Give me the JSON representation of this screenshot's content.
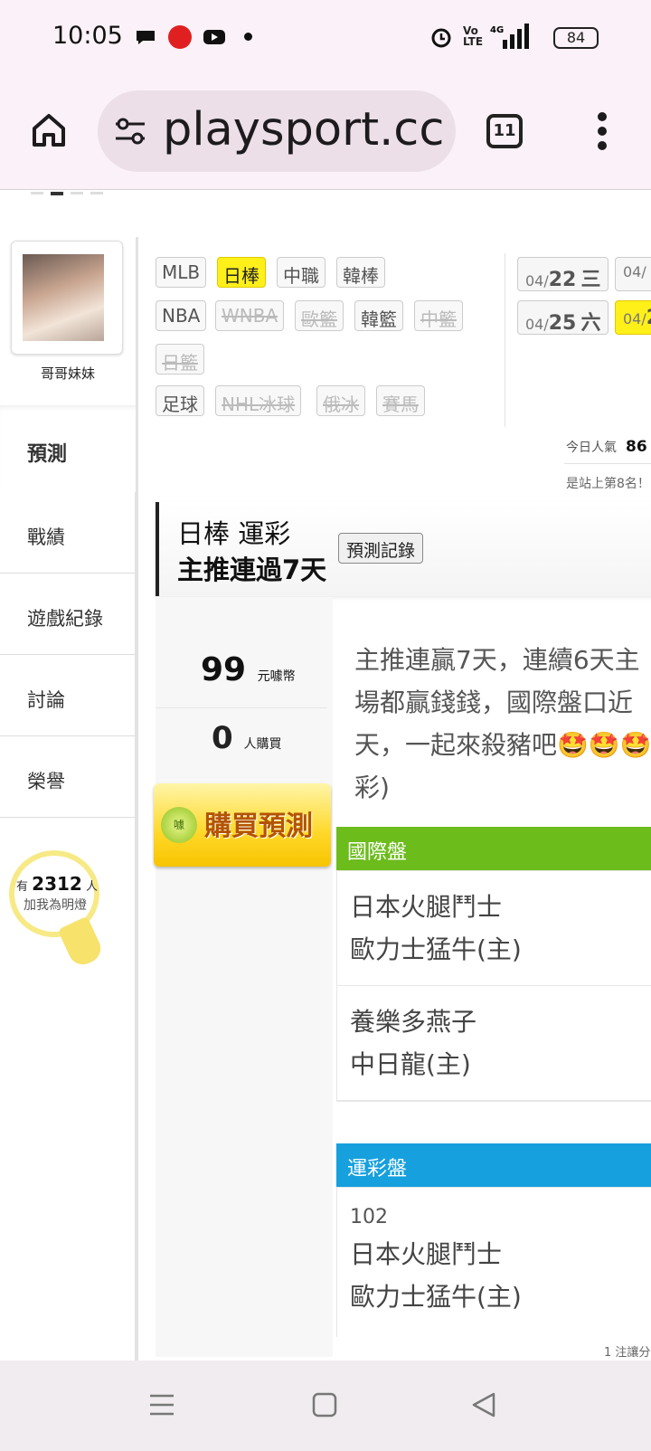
{
  "status_bar": {
    "time": "10:05",
    "battery": "84"
  },
  "browser": {
    "url": "playsport.cc",
    "tab_count": "11"
  },
  "profile": {
    "nickname": "哥哥妹妹"
  },
  "sidebar": {
    "items": [
      "預測",
      "戰績",
      "遊戲紀錄",
      "討論",
      "榮譽"
    ]
  },
  "lamp": {
    "prefix": "有",
    "count": "2312",
    "suffix": "人",
    "text": "加我為明燈"
  },
  "filters": {
    "row1": [
      "MLB",
      "日棒",
      "中職",
      "韓棒"
    ],
    "row2": [
      "NBA",
      "WNBA",
      "歐籃",
      "韓籃",
      "中籃"
    ],
    "row3": [
      "日籃"
    ],
    "row4": [
      "足球",
      "NHL冰球",
      "俄冰",
      "賽馬"
    ]
  },
  "dates": [
    {
      "md": "04/",
      "d": "22",
      "w": "三"
    },
    {
      "md": "04/",
      "d": "",
      "w": ""
    },
    {
      "md": "04/",
      "d": "25",
      "w": "六"
    },
    {
      "md": "04/",
      "d": "2",
      "w": ""
    }
  ],
  "popularity": {
    "label": "今日人氣",
    "value": "86",
    "rank": "是站上第8名！"
  },
  "prediction": {
    "title": "日棒 運彩",
    "subtitle": "主推連過7天",
    "record_button": "預測記錄",
    "price": "99",
    "price_unit": "元噱幣",
    "buyers": "0",
    "buyers_unit": "人購買",
    "buy_button": "購買預測",
    "coin": "噱",
    "description": "主推連贏7天，連續6天主場都贏錢錢，國際盤口近天，一起來殺豬吧🤩🤩🤩彩)"
  },
  "intl": {
    "header": "國際盤",
    "matches": [
      {
        "away": "日本火腿鬥士",
        "home": "歐力士猛牛(主)"
      },
      {
        "away": "養樂多燕子",
        "home": "中日龍(主)"
      }
    ]
  },
  "sports_lottery": {
    "header": "運彩盤",
    "number": "102",
    "away": "日本火腿鬥士",
    "home": "歐力士猛牛(主)"
  },
  "note": "1 注讓分",
  "colors": {
    "intl": "#6cbc1c",
    "lottery": "#16a0de",
    "highlight": "#fff01a"
  }
}
